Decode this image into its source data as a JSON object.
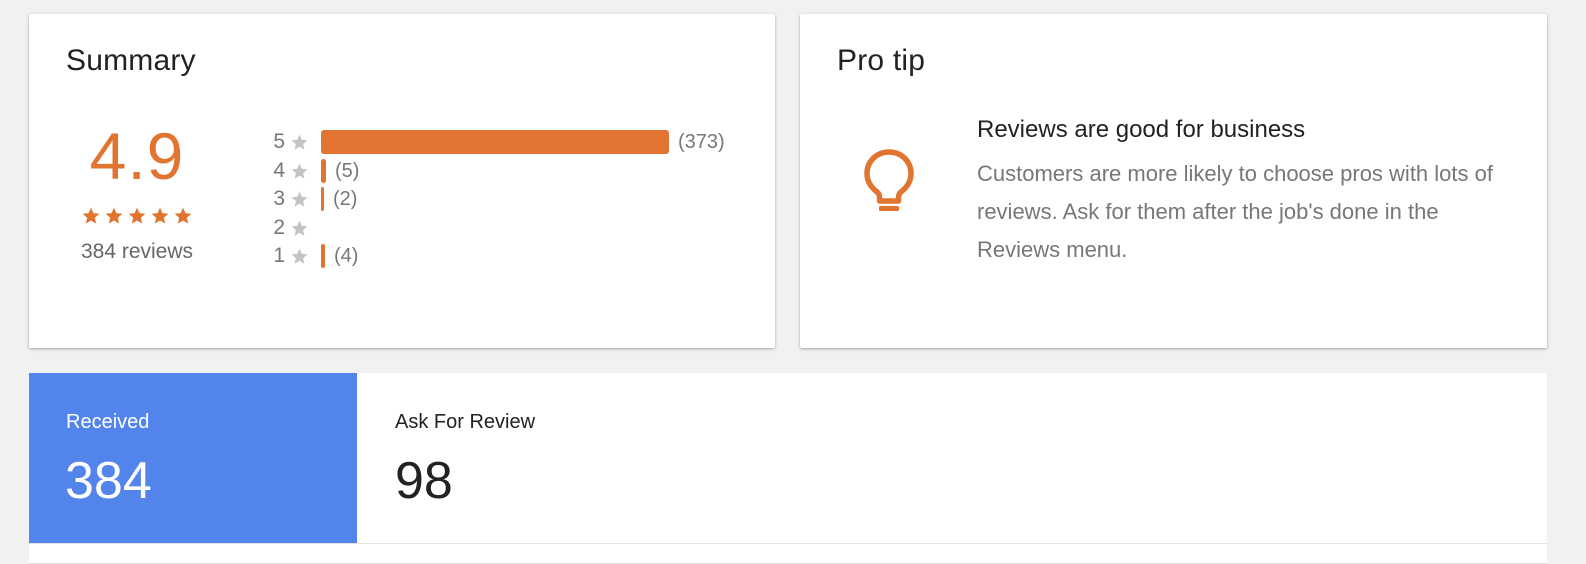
{
  "colors": {
    "accent": "#e07430",
    "star_gray": "#c4c4c4",
    "tab_active": "#5284ec"
  },
  "summary": {
    "title": "Summary",
    "rating": "4.9",
    "stars_filled": 5,
    "review_count_label": "384 reviews",
    "breakdown": [
      {
        "stars": "5",
        "count": 373,
        "count_label": "(373)"
      },
      {
        "stars": "4",
        "count": 5,
        "count_label": "(5)"
      },
      {
        "stars": "3",
        "count": 2,
        "count_label": "(2)"
      },
      {
        "stars": "2",
        "count": 0,
        "count_label": ""
      },
      {
        "stars": "1",
        "count": 4,
        "count_label": "(4)"
      }
    ]
  },
  "pro_tip": {
    "title": "Pro tip",
    "icon": "lightbulb-icon",
    "heading": "Reviews are good for business",
    "body": "Customers are more likely to choose pros with lots of reviews. Ask for them after the job's done in the Reviews menu."
  },
  "stats": {
    "received": {
      "label": "Received",
      "value": "384"
    },
    "ask_for_review": {
      "label": "Ask For Review",
      "value": "98"
    }
  }
}
